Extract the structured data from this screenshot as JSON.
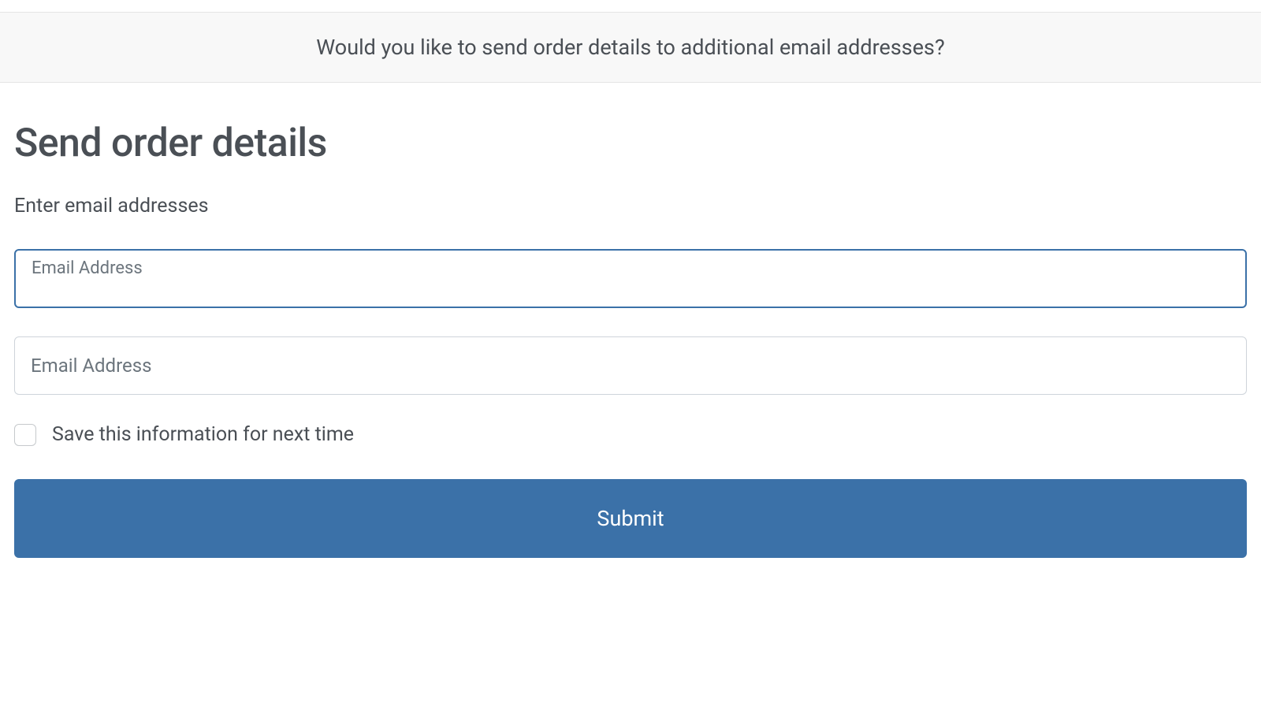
{
  "banner": {
    "prompt": "Would you like to send order details to additional email addresses?"
  },
  "form": {
    "title": "Send order details",
    "subtitle": "Enter email addresses",
    "email1": {
      "label": "Email Address",
      "value": ""
    },
    "email2": {
      "placeholder": "Email Address",
      "value": ""
    },
    "save_checkbox": {
      "label": "Save this information for next time",
      "checked": false
    },
    "submit_label": "Submit"
  }
}
